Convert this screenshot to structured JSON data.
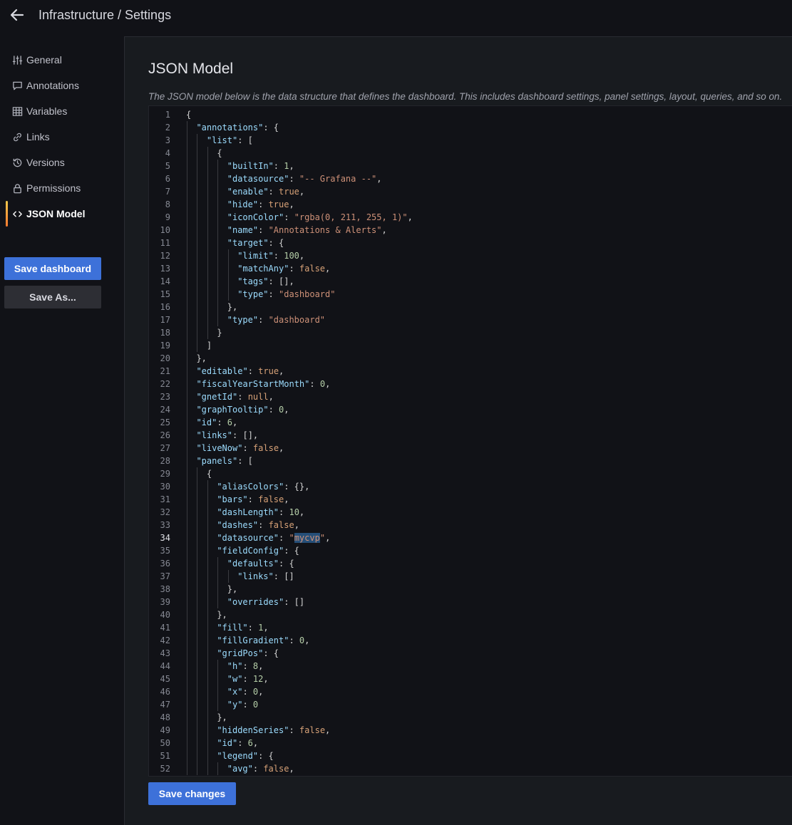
{
  "header": {
    "title": "Infrastructure / Settings",
    "back_icon": "arrow-left-icon"
  },
  "sidebar": {
    "items": [
      {
        "label": "General",
        "icon": "sliders-icon",
        "active": false
      },
      {
        "label": "Annotations",
        "icon": "comment-icon",
        "active": false
      },
      {
        "label": "Variables",
        "icon": "table-icon",
        "active": false
      },
      {
        "label": "Links",
        "icon": "link-icon",
        "active": false
      },
      {
        "label": "Versions",
        "icon": "history-icon",
        "active": false
      },
      {
        "label": "Permissions",
        "icon": "lock-icon",
        "active": false
      },
      {
        "label": "JSON Model",
        "icon": "code-brackets-icon",
        "active": true
      }
    ],
    "save_dashboard_label": "Save dashboard",
    "save_as_label": "Save As..."
  },
  "main": {
    "title": "JSON Model",
    "description": "The JSON model below is the data structure that defines the dashboard. This includes dashboard settings, panel settings, layout, queries, and so on.",
    "save_changes_label": "Save changes",
    "active_line": 34
  },
  "editor": {
    "lines": [
      [
        0,
        [
          [
            "p",
            "{"
          ]
        ]
      ],
      [
        1,
        [
          [
            "k",
            "\"annotations\""
          ],
          [
            "p",
            ": {"
          ]
        ]
      ],
      [
        2,
        [
          [
            "k",
            "\"list\""
          ],
          [
            "p",
            ": ["
          ]
        ]
      ],
      [
        3,
        [
          [
            "p",
            "{"
          ]
        ]
      ],
      [
        4,
        [
          [
            "k",
            "\"builtIn\""
          ],
          [
            "p",
            ": "
          ],
          [
            "n",
            "1"
          ],
          [
            "p",
            ","
          ]
        ]
      ],
      [
        4,
        [
          [
            "k",
            "\"datasource\""
          ],
          [
            "p",
            ": "
          ],
          [
            "s",
            "\"-- Grafana --\""
          ],
          [
            "p",
            ","
          ]
        ]
      ],
      [
        4,
        [
          [
            "k",
            "\"enable\""
          ],
          [
            "p",
            ": "
          ],
          [
            "b",
            "true"
          ],
          [
            "p",
            ","
          ]
        ]
      ],
      [
        4,
        [
          [
            "k",
            "\"hide\""
          ],
          [
            "p",
            ": "
          ],
          [
            "b",
            "true"
          ],
          [
            "p",
            ","
          ]
        ]
      ],
      [
        4,
        [
          [
            "k",
            "\"iconColor\""
          ],
          [
            "p",
            ": "
          ],
          [
            "s",
            "\"rgba(0, 211, 255, 1)\""
          ],
          [
            "p",
            ","
          ]
        ]
      ],
      [
        4,
        [
          [
            "k",
            "\"name\""
          ],
          [
            "p",
            ": "
          ],
          [
            "s",
            "\"Annotations & Alerts\""
          ],
          [
            "p",
            ","
          ]
        ]
      ],
      [
        4,
        [
          [
            "k",
            "\"target\""
          ],
          [
            "p",
            ": {"
          ]
        ]
      ],
      [
        5,
        [
          [
            "k",
            "\"limit\""
          ],
          [
            "p",
            ": "
          ],
          [
            "n",
            "100"
          ],
          [
            "p",
            ","
          ]
        ]
      ],
      [
        5,
        [
          [
            "k",
            "\"matchAny\""
          ],
          [
            "p",
            ": "
          ],
          [
            "b",
            "false"
          ],
          [
            "p",
            ","
          ]
        ]
      ],
      [
        5,
        [
          [
            "k",
            "\"tags\""
          ],
          [
            "p",
            ": [],"
          ]
        ]
      ],
      [
        5,
        [
          [
            "k",
            "\"type\""
          ],
          [
            "p",
            ": "
          ],
          [
            "s",
            "\"dashboard\""
          ]
        ]
      ],
      [
        4,
        [
          [
            "p",
            "},"
          ]
        ]
      ],
      [
        4,
        [
          [
            "k",
            "\"type\""
          ],
          [
            "p",
            ": "
          ],
          [
            "s",
            "\"dashboard\""
          ]
        ]
      ],
      [
        3,
        [
          [
            "p",
            "}"
          ]
        ]
      ],
      [
        2,
        [
          [
            "p",
            "]"
          ]
        ]
      ],
      [
        1,
        [
          [
            "p",
            "},"
          ]
        ]
      ],
      [
        1,
        [
          [
            "k",
            "\"editable\""
          ],
          [
            "p",
            ": "
          ],
          [
            "b",
            "true"
          ],
          [
            "p",
            ","
          ]
        ]
      ],
      [
        1,
        [
          [
            "k",
            "\"fiscalYearStartMonth\""
          ],
          [
            "p",
            ": "
          ],
          [
            "n",
            "0"
          ],
          [
            "p",
            ","
          ]
        ]
      ],
      [
        1,
        [
          [
            "k",
            "\"gnetId\""
          ],
          [
            "p",
            ": "
          ],
          [
            "b",
            "null"
          ],
          [
            "p",
            ","
          ]
        ]
      ],
      [
        1,
        [
          [
            "k",
            "\"graphTooltip\""
          ],
          [
            "p",
            ": "
          ],
          [
            "n",
            "0"
          ],
          [
            "p",
            ","
          ]
        ]
      ],
      [
        1,
        [
          [
            "k",
            "\"id\""
          ],
          [
            "p",
            ": "
          ],
          [
            "n",
            "6"
          ],
          [
            "p",
            ","
          ]
        ]
      ],
      [
        1,
        [
          [
            "k",
            "\"links\""
          ],
          [
            "p",
            ": [],"
          ]
        ]
      ],
      [
        1,
        [
          [
            "k",
            "\"liveNow\""
          ],
          [
            "p",
            ": "
          ],
          [
            "b",
            "false"
          ],
          [
            "p",
            ","
          ]
        ]
      ],
      [
        1,
        [
          [
            "k",
            "\"panels\""
          ],
          [
            "p",
            ": ["
          ]
        ]
      ],
      [
        2,
        [
          [
            "p",
            "{"
          ]
        ]
      ],
      [
        3,
        [
          [
            "k",
            "\"aliasColors\""
          ],
          [
            "p",
            ": {},"
          ]
        ]
      ],
      [
        3,
        [
          [
            "k",
            "\"bars\""
          ],
          [
            "p",
            ": "
          ],
          [
            "b",
            "false"
          ],
          [
            "p",
            ","
          ]
        ]
      ],
      [
        3,
        [
          [
            "k",
            "\"dashLength\""
          ],
          [
            "p",
            ": "
          ],
          [
            "n",
            "10"
          ],
          [
            "p",
            ","
          ]
        ]
      ],
      [
        3,
        [
          [
            "k",
            "\"dashes\""
          ],
          [
            "p",
            ": "
          ],
          [
            "b",
            "false"
          ],
          [
            "p",
            ","
          ]
        ]
      ],
      [
        3,
        [
          [
            "k",
            "\"datasource\""
          ],
          [
            "p",
            ": "
          ],
          [
            "s",
            "\""
          ],
          [
            "hl",
            "mycvp"
          ],
          [
            "s",
            "\""
          ],
          [
            "p",
            ","
          ]
        ]
      ],
      [
        3,
        [
          [
            "k",
            "\"fieldConfig\""
          ],
          [
            "p",
            ": {"
          ]
        ]
      ],
      [
        4,
        [
          [
            "k",
            "\"defaults\""
          ],
          [
            "p",
            ": {"
          ]
        ]
      ],
      [
        5,
        [
          [
            "k",
            "\"links\""
          ],
          [
            "p",
            ": []"
          ]
        ]
      ],
      [
        4,
        [
          [
            "p",
            "},"
          ]
        ]
      ],
      [
        4,
        [
          [
            "k",
            "\"overrides\""
          ],
          [
            "p",
            ": []"
          ]
        ]
      ],
      [
        3,
        [
          [
            "p",
            "},"
          ]
        ]
      ],
      [
        3,
        [
          [
            "k",
            "\"fill\""
          ],
          [
            "p",
            ": "
          ],
          [
            "n",
            "1"
          ],
          [
            "p",
            ","
          ]
        ]
      ],
      [
        3,
        [
          [
            "k",
            "\"fillGradient\""
          ],
          [
            "p",
            ": "
          ],
          [
            "n",
            "0"
          ],
          [
            "p",
            ","
          ]
        ]
      ],
      [
        3,
        [
          [
            "k",
            "\"gridPos\""
          ],
          [
            "p",
            ": {"
          ]
        ]
      ],
      [
        4,
        [
          [
            "k",
            "\"h\""
          ],
          [
            "p",
            ": "
          ],
          [
            "n",
            "8"
          ],
          [
            "p",
            ","
          ]
        ]
      ],
      [
        4,
        [
          [
            "k",
            "\"w\""
          ],
          [
            "p",
            ": "
          ],
          [
            "n",
            "12"
          ],
          [
            "p",
            ","
          ]
        ]
      ],
      [
        4,
        [
          [
            "k",
            "\"x\""
          ],
          [
            "p",
            ": "
          ],
          [
            "n",
            "0"
          ],
          [
            "p",
            ","
          ]
        ]
      ],
      [
        4,
        [
          [
            "k",
            "\"y\""
          ],
          [
            "p",
            ": "
          ],
          [
            "n",
            "0"
          ]
        ]
      ],
      [
        3,
        [
          [
            "p",
            "},"
          ]
        ]
      ],
      [
        3,
        [
          [
            "k",
            "\"hiddenSeries\""
          ],
          [
            "p",
            ": "
          ],
          [
            "b",
            "false"
          ],
          [
            "p",
            ","
          ]
        ]
      ],
      [
        3,
        [
          [
            "k",
            "\"id\""
          ],
          [
            "p",
            ": "
          ],
          [
            "n",
            "6"
          ],
          [
            "p",
            ","
          ]
        ]
      ],
      [
        3,
        [
          [
            "k",
            "\"legend\""
          ],
          [
            "p",
            ": {"
          ]
        ]
      ],
      [
        4,
        [
          [
            "k",
            "\"avg\""
          ],
          [
            "p",
            ": "
          ],
          [
            "b",
            "false"
          ],
          [
            "p",
            ","
          ]
        ]
      ]
    ]
  },
  "colors": {
    "primary_button": "#3d71d9",
    "active_indicator": "#ff7a2f",
    "json_key": "#9cdcfe",
    "json_string": "#ce9178",
    "json_number": "#b5cea8",
    "json_keyword": "#d7a177"
  }
}
